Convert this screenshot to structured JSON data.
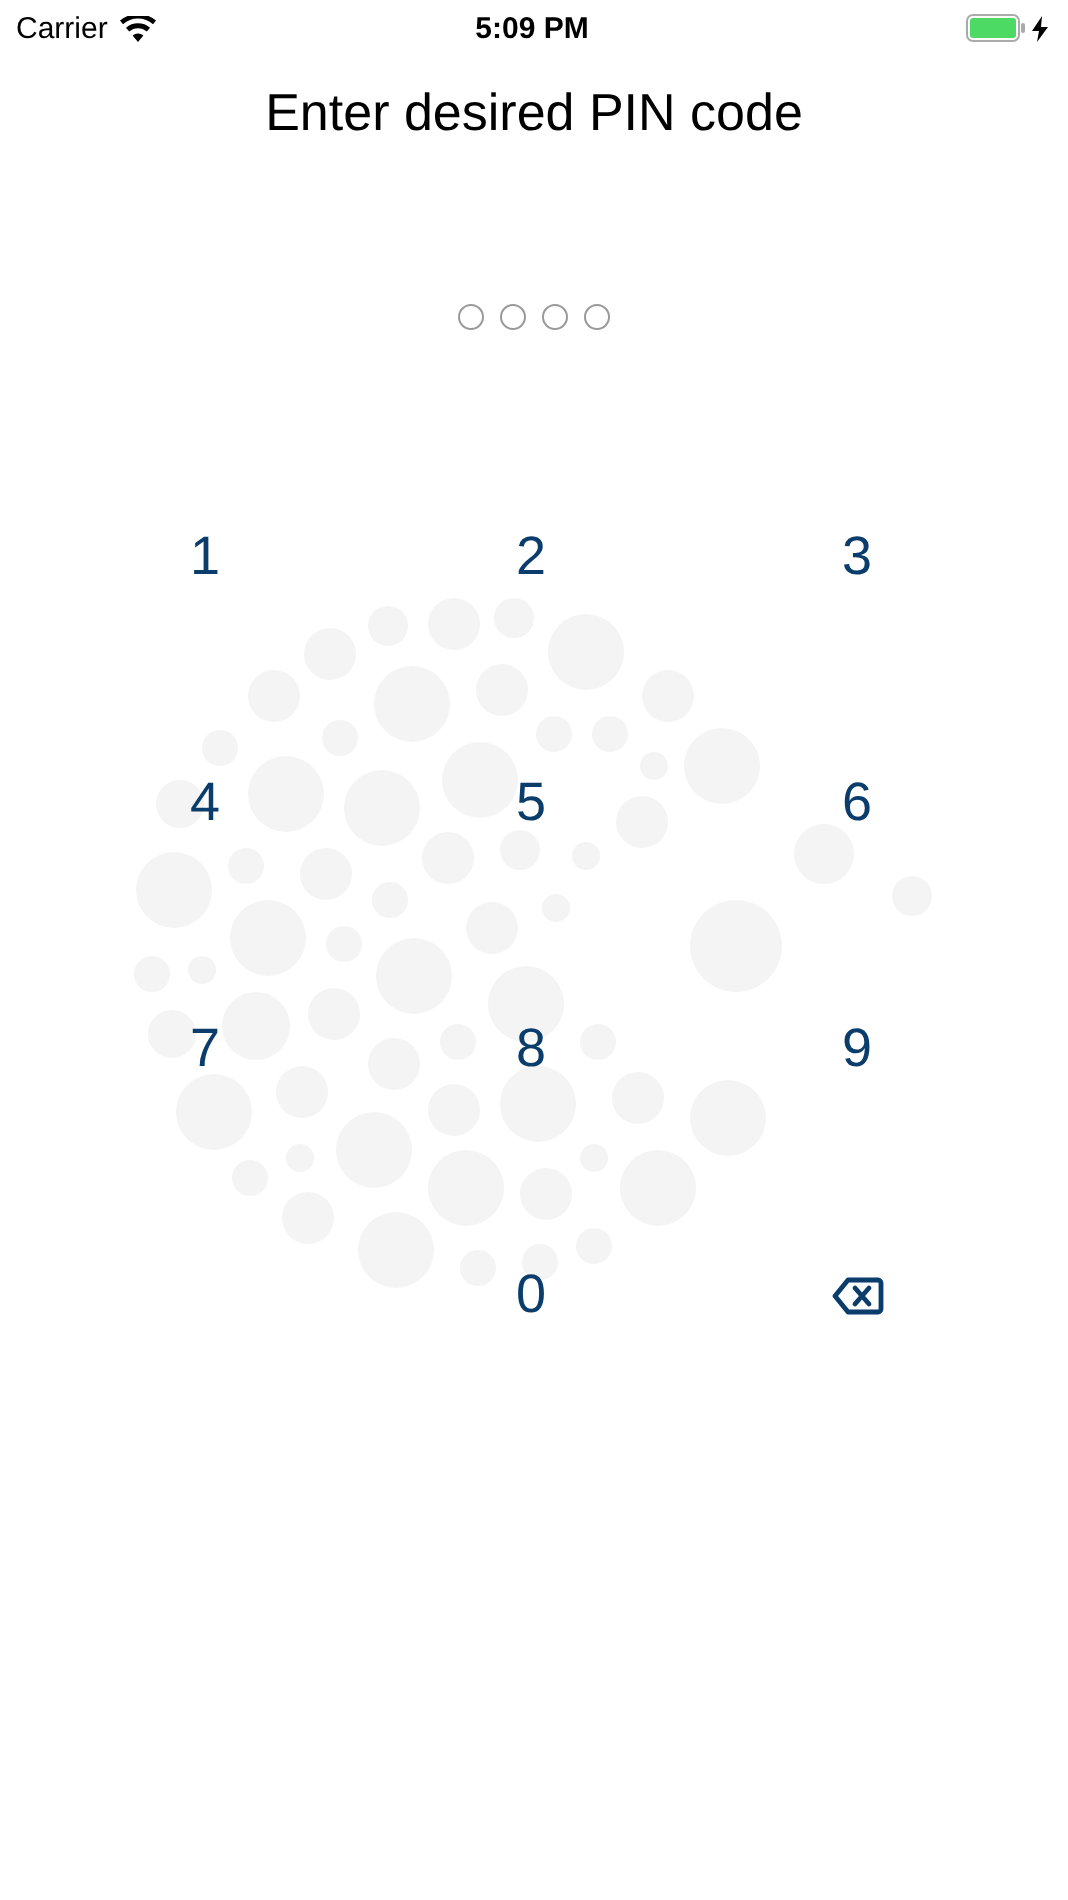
{
  "status_bar": {
    "carrier": "Carrier",
    "time": "5:09 PM",
    "charging": true
  },
  "title": "Enter desired PIN code",
  "pin_dots": [
    {
      "filled": false
    },
    {
      "filled": false
    },
    {
      "filled": false
    },
    {
      "filled": false
    }
  ],
  "keypad": [
    {
      "kind": "digit",
      "label": "1"
    },
    {
      "kind": "digit",
      "label": "2"
    },
    {
      "kind": "digit",
      "label": "3"
    },
    {
      "kind": "digit",
      "label": "4"
    },
    {
      "kind": "digit",
      "label": "5"
    },
    {
      "kind": "digit",
      "label": "6"
    },
    {
      "kind": "digit",
      "label": "7"
    },
    {
      "kind": "digit",
      "label": "8"
    },
    {
      "kind": "digit",
      "label": "9"
    },
    {
      "kind": "empty"
    },
    {
      "kind": "digit",
      "label": "0"
    },
    {
      "kind": "delete"
    }
  ]
}
